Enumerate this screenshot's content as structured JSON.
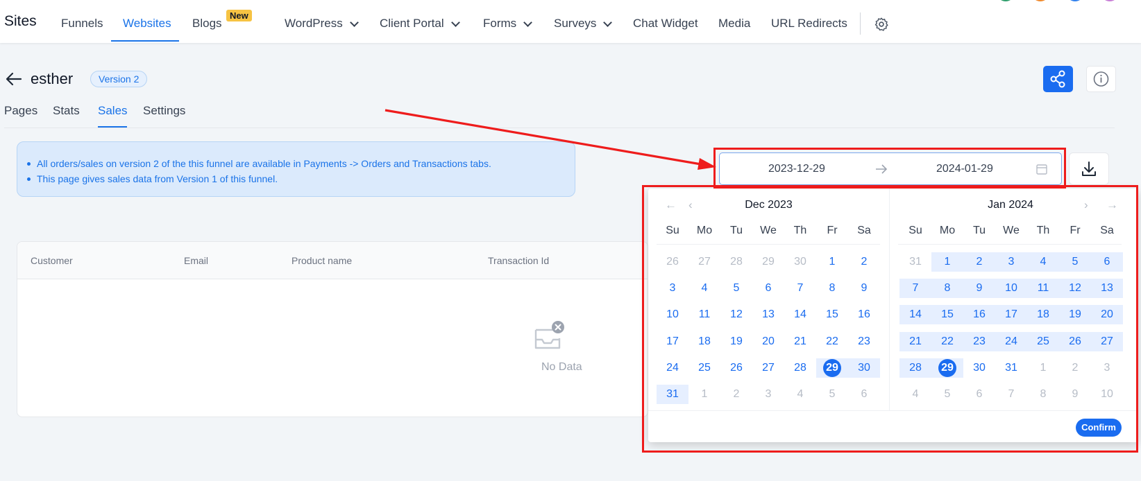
{
  "nav": {
    "brand": "Sites",
    "items": [
      {
        "label": "Funnels"
      },
      {
        "label": "Websites"
      },
      {
        "label": "Blogs"
      },
      {
        "label": "WordPress"
      },
      {
        "label": "Client Portal"
      },
      {
        "label": "Forms"
      },
      {
        "label": "Surveys"
      },
      {
        "label": "Chat Widget"
      },
      {
        "label": "Media"
      },
      {
        "label": "URL Redirects"
      }
    ],
    "badge": "New",
    "active": "Websites"
  },
  "header": {
    "site_name": "esther",
    "version": "Version 2"
  },
  "tabs": [
    {
      "label": "Pages"
    },
    {
      "label": "Stats"
    },
    {
      "label": "Sales"
    },
    {
      "label": "Settings"
    }
  ],
  "active_tab": "Sales",
  "info": {
    "lines": [
      "All orders/sales on version 2 of the this funnel are available in Payments -> Orders and Transactions tabs.",
      "This page gives sales data from Version 1 of this funnel."
    ]
  },
  "date_range": {
    "start": "2023-12-29",
    "end": "2024-01-29"
  },
  "table": {
    "columns": [
      "Customer",
      "Email",
      "Product name",
      "Transaction Id"
    ],
    "empty_text": "No Data"
  },
  "calendar": {
    "weekdays": [
      "Su",
      "Mo",
      "Tu",
      "We",
      "Th",
      "Fr",
      "Sa"
    ],
    "nav": {
      "prev_year": "←",
      "prev_month": "‹",
      "next_month": "›",
      "next_year": "→"
    },
    "months": [
      {
        "title": "Dec 2023",
        "days": [
          {
            "d": "26",
            "o": true
          },
          {
            "d": "27",
            "o": true
          },
          {
            "d": "28",
            "o": true
          },
          {
            "d": "29",
            "o": true
          },
          {
            "d": "30",
            "o": true
          },
          {
            "d": "1"
          },
          {
            "d": "2"
          },
          {
            "d": "3"
          },
          {
            "d": "4"
          },
          {
            "d": "5"
          },
          {
            "d": "6"
          },
          {
            "d": "7"
          },
          {
            "d": "8"
          },
          {
            "d": "9"
          },
          {
            "d": "10"
          },
          {
            "d": "11"
          },
          {
            "d": "12"
          },
          {
            "d": "13"
          },
          {
            "d": "14"
          },
          {
            "d": "15"
          },
          {
            "d": "16"
          },
          {
            "d": "17"
          },
          {
            "d": "18"
          },
          {
            "d": "19"
          },
          {
            "d": "20"
          },
          {
            "d": "21"
          },
          {
            "d": "22"
          },
          {
            "d": "23"
          },
          {
            "d": "24"
          },
          {
            "d": "25"
          },
          {
            "d": "26"
          },
          {
            "d": "27"
          },
          {
            "d": "28"
          },
          {
            "d": "29",
            "s": true
          },
          {
            "d": "30",
            "r": true
          },
          {
            "d": "31",
            "r": true
          },
          {
            "d": "1",
            "o": true
          },
          {
            "d": "2",
            "o": true
          },
          {
            "d": "3",
            "o": true
          },
          {
            "d": "4",
            "o": true
          },
          {
            "d": "5",
            "o": true
          },
          {
            "d": "6",
            "o": true
          }
        ]
      },
      {
        "title": "Jan 2024",
        "days": [
          {
            "d": "31",
            "o": true
          },
          {
            "d": "1",
            "r": true
          },
          {
            "d": "2",
            "r": true
          },
          {
            "d": "3",
            "r": true
          },
          {
            "d": "4",
            "r": true
          },
          {
            "d": "5",
            "r": true
          },
          {
            "d": "6",
            "r": true
          },
          {
            "d": "7",
            "r": true
          },
          {
            "d": "8",
            "r": true
          },
          {
            "d": "9",
            "r": true
          },
          {
            "d": "10",
            "r": true
          },
          {
            "d": "11",
            "r": true
          },
          {
            "d": "12",
            "r": true
          },
          {
            "d": "13",
            "r": true
          },
          {
            "d": "14",
            "r": true
          },
          {
            "d": "15",
            "r": true
          },
          {
            "d": "16",
            "r": true
          },
          {
            "d": "17",
            "r": true
          },
          {
            "d": "18",
            "r": true
          },
          {
            "d": "19",
            "r": true
          },
          {
            "d": "20",
            "r": true
          },
          {
            "d": "21",
            "r": true
          },
          {
            "d": "22",
            "r": true
          },
          {
            "d": "23",
            "r": true
          },
          {
            "d": "24",
            "r": true
          },
          {
            "d": "25",
            "r": true
          },
          {
            "d": "26",
            "r": true
          },
          {
            "d": "27",
            "r": true
          },
          {
            "d": "28",
            "r": true
          },
          {
            "d": "29",
            "s": true
          },
          {
            "d": "30"
          },
          {
            "d": "31"
          },
          {
            "d": "1",
            "o": true
          },
          {
            "d": "2",
            "o": true
          },
          {
            "d": "3",
            "o": true
          },
          {
            "d": "4",
            "o": true
          },
          {
            "d": "5",
            "o": true
          },
          {
            "d": "6",
            "o": true
          },
          {
            "d": "7",
            "o": true
          },
          {
            "d": "8",
            "o": true
          },
          {
            "d": "9",
            "o": true
          },
          {
            "d": "10",
            "o": true
          }
        ]
      }
    ],
    "confirm_label": "Confirm"
  },
  "colors": {
    "accent": "#1a6cf0",
    "annotation": "#ee1c1c"
  }
}
